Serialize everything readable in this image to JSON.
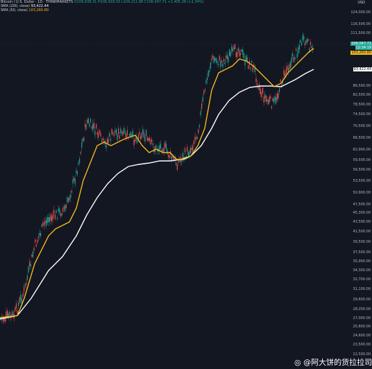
{
  "header": {
    "symbol": "Bitcoin / U.S. Dollar · 1D · THINKMARKETS",
    "ohlc": "O106,638.31 H106,918.03 L104,211.88 C106,047.71 +1,405.28 (+1.34%)",
    "sma1_label": "SMA (200, close)",
    "sma1_value": "93,422.44",
    "sma2_label": "SMA (50, close)",
    "sma2_value": "103,260.80"
  },
  "axis": {
    "currency": "USD",
    "ticks": [
      "124,000.00",
      "116,500.00",
      "111,500.00",
      "104,500.00",
      "93,500.00",
      "86,500.00",
      "82,500.00",
      "78,500.00",
      "74,500.00",
      "70,500.00",
      "66,500.00",
      "62,900.00",
      "59,500.00",
      "56,500.00",
      "53,500.00",
      "50,900.00",
      "47,500.00",
      "45,300.00",
      "43,500.00",
      "41,500.00",
      "39,500.00",
      "37,500.00",
      "35,900.00",
      "34,300.00",
      "32,700.00",
      "31,100.00",
      "29,600.00",
      "28,200.00",
      "27,000.00",
      "25,800.00",
      "24,600.00",
      "23,500.00",
      "22,500.00"
    ]
  },
  "price_tags": {
    "last": "106,047.71",
    "countdown": "12:34:19",
    "sma50": "103,260.80",
    "sma200": "93,422.44"
  },
  "colors": {
    "background": "#131722",
    "up": "#26a69a",
    "down": "#ef5350",
    "sma50": "#f5b81c",
    "sma200": "#ffffff"
  },
  "watermark": "◎ @阿大饼的货拉拉司机"
}
